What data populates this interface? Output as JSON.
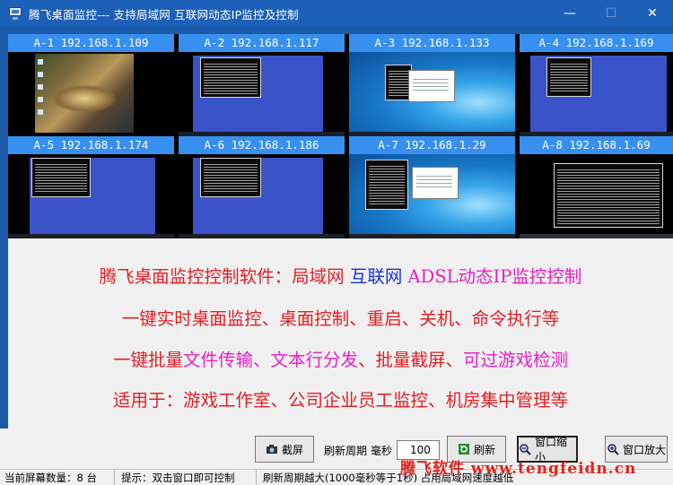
{
  "window": {
    "title": "腾飞桌面监控--- 支持局域网 互联网动态IP监控及控制",
    "minimize_glyph": "—",
    "maximize_glyph": "☐",
    "close_glyph": "✕"
  },
  "monitors": [
    {
      "label": "A-1 192.168.1.109",
      "screen": "game"
    },
    {
      "label": "A-2 192.168.1.117",
      "screen": "blue-desktop-console"
    },
    {
      "label": "A-3 192.168.1.133",
      "screen": "win10-desktop-dialog"
    },
    {
      "label": "A-4 192.168.1.169",
      "screen": "blue-desktop-console"
    },
    {
      "label": "A-5 192.168.1.174",
      "screen": "blue-desktop-console"
    },
    {
      "label": "A-6 192.168.1.186",
      "screen": "blue-desktop-console"
    },
    {
      "label": "A-7 192.168.1.29",
      "screen": "win10-desktop-dialog"
    },
    {
      "label": "A-8 192.168.1.69",
      "screen": "black-console"
    }
  ],
  "info": {
    "line1": {
      "a": "腾飞桌面监控控制软件：局域网",
      "b": "互联网",
      "c": "ADSL动态IP监控控制"
    },
    "line2": "一键实时桌面监控、桌面控制、重启、关机、命令执行等",
    "line3": {
      "a": "一键批量",
      "b": "文件传输、文本行分发",
      "c": "、批量截屏、",
      "d": "可过游戏检测"
    },
    "line4": "适用于：游戏工作室、公司企业员工监控、机房集中管理等"
  },
  "toolbar": {
    "screenshot_label": "截屏",
    "refresh_period_label": "刷新周期",
    "ms_label": "毫秒",
    "refresh_value": "100",
    "refresh_label": "刷新",
    "shrink_label": "窗口缩小",
    "enlarge_label": "窗口放大"
  },
  "status": {
    "screen_count": "当前屏幕数量：8 台",
    "hint": "提示：双击窗口即可控制",
    "note": "刷新周期越大(1000毫秒等于1秒) 占用局域网速度越低"
  },
  "watermark": "腾飞软件 www.tengfeidn.cn",
  "colors": {
    "titlebar": "#1c60b8",
    "tile_label": "#3790f0",
    "red": "#e11f26",
    "blue": "#1d33d6",
    "magenta": "#e61fc6"
  }
}
